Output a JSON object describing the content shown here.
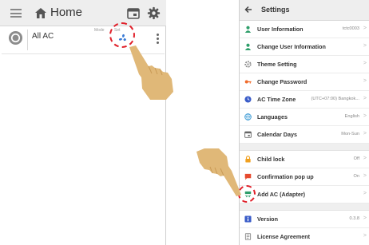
{
  "home": {
    "title": "Home",
    "ac_name": "All AC",
    "mode_label": "Mode",
    "set_label": "Set"
  },
  "settings": {
    "title": "Settings",
    "rows": [
      {
        "label": "User Information",
        "value": "tctc0003"
      },
      {
        "label": "Change User Information",
        "value": ""
      },
      {
        "label": "Theme Setting",
        "value": ""
      },
      {
        "label": "Change Password",
        "value": ""
      },
      {
        "label": "AC Time Zone",
        "value": "(UTC+07:00) Bangkok..."
      },
      {
        "label": "Languages",
        "value": "English"
      },
      {
        "label": "Calendar Days",
        "value": "Mon-Sun"
      },
      {
        "label": "Child lock",
        "value": "Off"
      },
      {
        "label": "Confirmation pop up",
        "value": "On"
      },
      {
        "label": "Add AC (Adapter)",
        "value": ""
      },
      {
        "label": "Version",
        "value": "0.3.8"
      },
      {
        "label": "License Agreement",
        "value": ""
      }
    ]
  },
  "colors": {
    "highlight": "#e0202a",
    "hand": "#e0b878",
    "icon_green": "#2e9e6a",
    "icon_orange": "#f0a020",
    "icon_red": "#e64a2e",
    "icon_blue": "#3a5cc8"
  }
}
